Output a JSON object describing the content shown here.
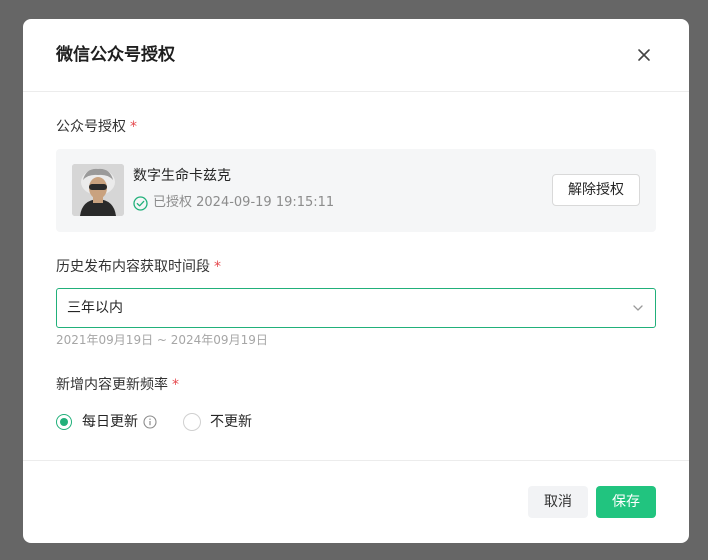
{
  "dialog": {
    "title": "微信公众号授权",
    "close_icon": "close-icon"
  },
  "account_section": {
    "label": "公众号授权",
    "required_mark": "*",
    "account": {
      "name": "数字生命卡兹克",
      "status_icon": "check-circle-icon",
      "status_text": "已授权 2024-09-19 19:15:11",
      "revoke_label": "解除授权"
    }
  },
  "history_section": {
    "label": "历史发布内容获取时间段",
    "required_mark": "*",
    "selected": "三年以内",
    "arrow_icon": "chevron-down-icon",
    "range_hint": "2021年09月19日 ~ 2024年09月19日"
  },
  "frequency_section": {
    "label": "新增内容更新频率",
    "required_mark": "*",
    "options": [
      {
        "label": "每日更新",
        "checked": true,
        "has_info": true
      },
      {
        "label": "不更新",
        "checked": false
      }
    ]
  },
  "footer": {
    "cancel_label": "取消",
    "save_label": "保存"
  },
  "colors": {
    "accent": "#21c47f",
    "accent_border": "#21b07a",
    "required": "#e5484d"
  }
}
